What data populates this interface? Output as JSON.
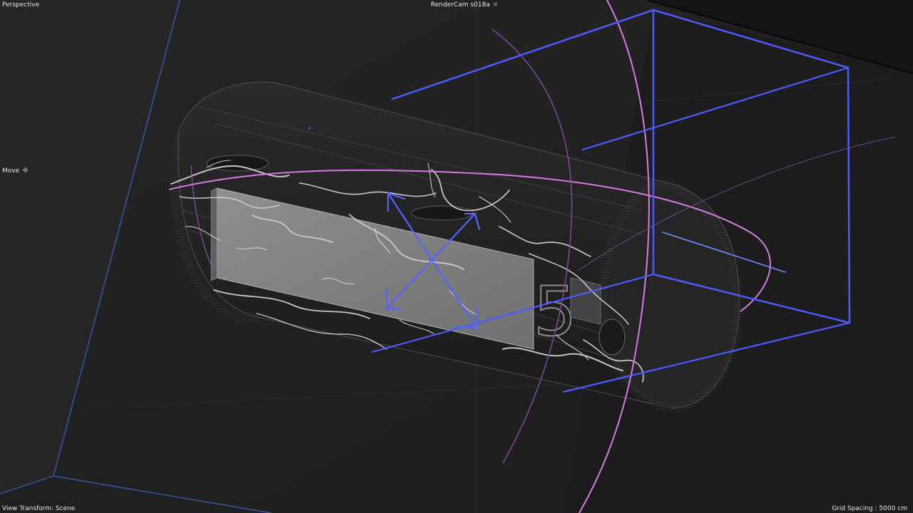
{
  "viewport": {
    "view_label": "Perspective",
    "camera_label": "RenderCam s018a",
    "camera_icon": "camera-icon",
    "tool_label": "Move",
    "tool_icon": "move-icon",
    "view_transform_label": "View Transform: Scene",
    "grid_spacing_label": "Grid Spacing : 5000 cm",
    "scene_text": "5"
  },
  "colors": {
    "background": "#232323",
    "gizmo_blue": "#4b5cff",
    "manipulator_pink": "#d77ce6",
    "hud_text": "#e6e6e6",
    "wireframe": "#7b7b7b"
  }
}
